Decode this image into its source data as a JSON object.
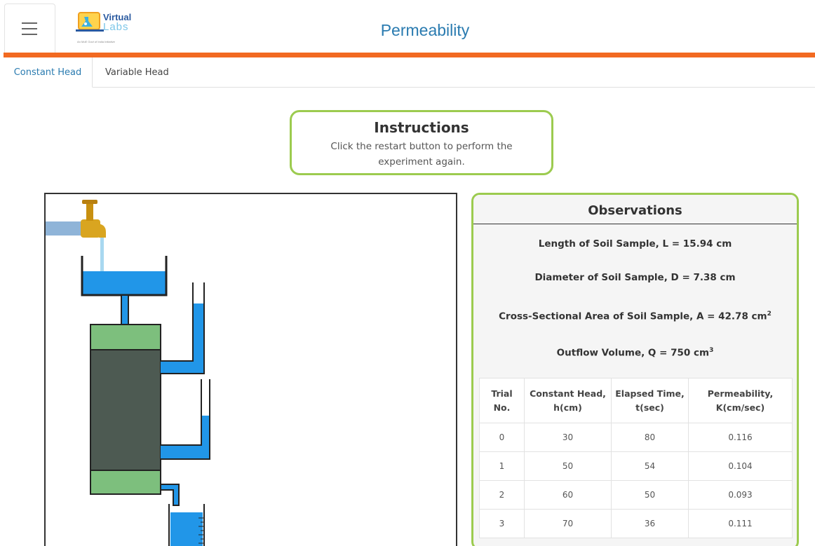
{
  "app": {
    "logo_line1": "Virtual",
    "logo_line2": "Labs",
    "logo_tagline": "An MoE Govt of India Initiative",
    "title": "Permeability"
  },
  "colors": {
    "accent_orange": "#f26a21",
    "title_blue": "#2a7bb0",
    "panel_green": "#9ccb4f",
    "water_blue": "#2196e8",
    "soil_dark": "#4d5a52",
    "filter_green": "#7dbf7d",
    "tap_gold": "#d9a520"
  },
  "icons": [
    "hamburger-menu-icon",
    "virtual-labs-logo",
    "water-tap-icon"
  ],
  "tabs": [
    {
      "label": "Constant Head",
      "active": true
    },
    {
      "label": "Variable Head",
      "active": false
    }
  ],
  "instructions": {
    "title": "Instructions",
    "text": "Click the restart button to perform the experiment again."
  },
  "observations": {
    "title": "Observations",
    "length": "Length of Soil Sample, L = 15.94 cm",
    "diameter": "Diameter of Soil Sample, D = 7.38 cm",
    "area_prefix": "Cross-Sectional Area of Soil Sample, A = 42.78 cm",
    "area_exp": "2",
    "volume_prefix": "Outflow Volume, Q = 750 cm",
    "volume_exp": "3",
    "headers": [
      "Trial No.",
      "Constant Head, h(cm)",
      "Elapsed Time, t(sec)",
      "Permeability, K(cm/sec)"
    ],
    "rows": [
      [
        "0",
        "30",
        "80",
        "0.116"
      ],
      [
        "1",
        "50",
        "54",
        "0.104"
      ],
      [
        "2",
        "60",
        "50",
        "0.093"
      ],
      [
        "3",
        "70",
        "36",
        "0.111"
      ]
    ]
  }
}
